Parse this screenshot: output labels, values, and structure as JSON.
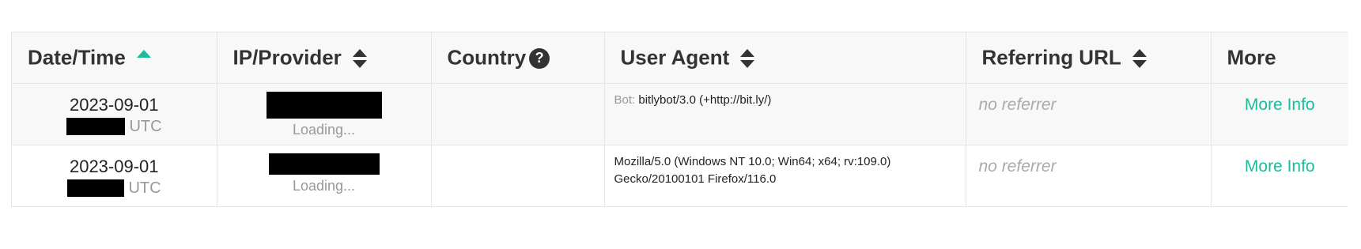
{
  "columns": {
    "datetime": "Date/Time",
    "ip": "IP/Provider",
    "country": "Country",
    "country_help": "?",
    "useragent": "User Agent",
    "referrer": "Referring URL",
    "more": "More"
  },
  "sort": {
    "active_column": "datetime",
    "direction": "ascending"
  },
  "colors": {
    "accent": "#1abc9c",
    "redaction": "#000000"
  },
  "rows": [
    {
      "date": "2023-09-01",
      "time_suffix": "UTC",
      "ip_status": "Loading...",
      "country": "",
      "ua_prefix": "Bot:",
      "user_agent": "bitlybot/3.0 (+http://bit.ly/)",
      "referrer": "no referrer",
      "more_label": "More Info"
    },
    {
      "date": "2023-09-01",
      "time_suffix": "UTC",
      "ip_status": "Loading...",
      "country": "",
      "ua_prefix": "",
      "user_agent": "Mozilla/5.0 (Windows NT 10.0; Win64; x64; rv:109.0) Gecko/20100101 Firefox/116.0",
      "referrer": "no referrer",
      "more_label": "More Info"
    }
  ]
}
